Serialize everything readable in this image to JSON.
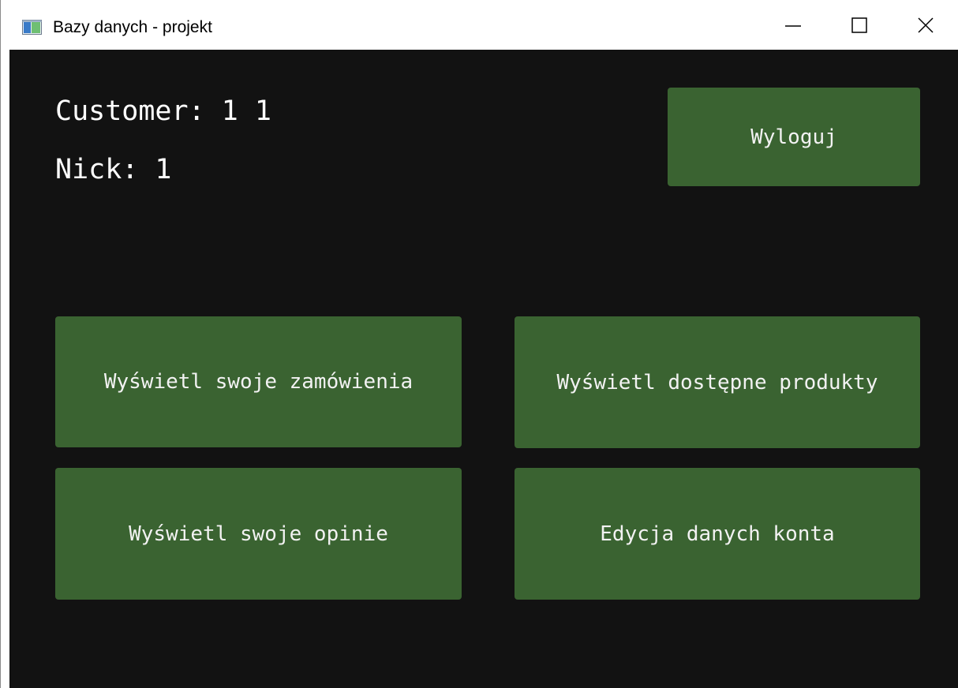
{
  "window": {
    "title": "Bazy danych - projekt",
    "icon": "application-icon",
    "controls": {
      "minimize_icon": "minimize-icon",
      "maximize_icon": "maximize-icon",
      "close_icon": "close-icon"
    }
  },
  "user": {
    "customer_label": "Customer: 1 1",
    "nick_label": "Nick: 1"
  },
  "buttons": {
    "logout": "Wyloguj",
    "orders": "Wyświetl swoje zamówienia",
    "products": "Wyświetl dostępne produkty",
    "reviews": "Wyświetl swoje opinie",
    "account": "Edycja danych konta"
  },
  "colors": {
    "background": "#121212",
    "button": "#3a6331",
    "text": "#ffffff"
  }
}
